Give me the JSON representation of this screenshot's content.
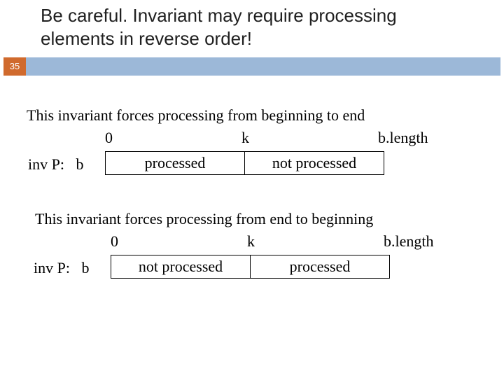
{
  "slide": {
    "title": "Be careful. Invariant may require processing elements in reverse order!",
    "number": "35"
  },
  "sec1": {
    "caption": "This invariant forces processing from beginning to end",
    "labels": {
      "zero": "0",
      "k": "k",
      "blen": "b.length"
    },
    "inv": "inv P:   b",
    "left_box": "processed",
    "right_box": "not processed"
  },
  "sec2": {
    "caption": "This invariant forces processing from end to beginning",
    "labels": {
      "zero": "0",
      "k": "k",
      "blen": "b.length"
    },
    "inv": "inv P:   b",
    "left_box": "not processed",
    "right_box": "processed"
  }
}
